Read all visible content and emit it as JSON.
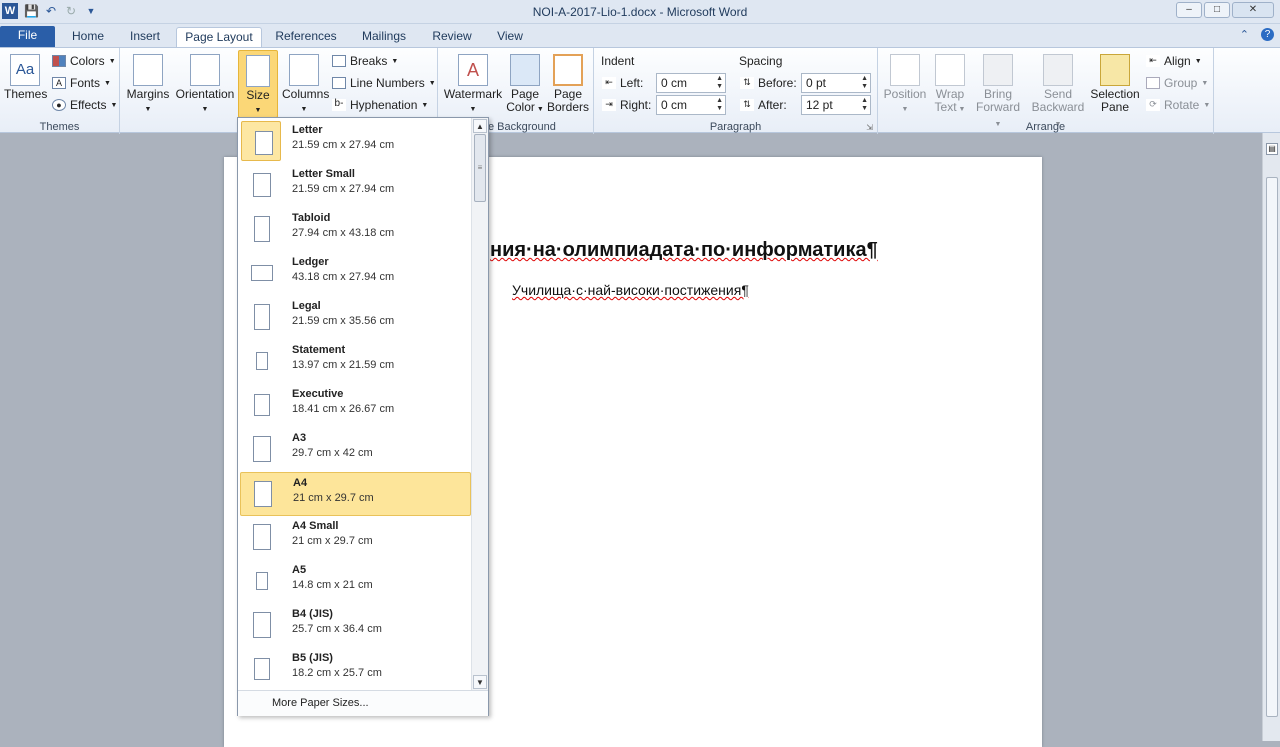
{
  "window": {
    "title": "NOI-A-2017-Lio-1.docx - Microsoft Word",
    "logo": "W",
    "minimize": "–",
    "maximize": "□",
    "close": "✕"
  },
  "tabs": [
    "File",
    "Home",
    "Insert",
    "Page Layout",
    "References",
    "Mailings",
    "Review",
    "View"
  ],
  "ribbon": {
    "themes": {
      "themes_label": "Themes",
      "colors": "Colors",
      "fonts": "Fonts",
      "effects": "Effects",
      "group": "Themes"
    },
    "page_setup": {
      "margins": "Margins",
      "orientation": "Orientation",
      "size": "Size",
      "columns": "Columns",
      "breaks": "Breaks",
      "line_numbers": "Line Numbers",
      "hyphenation": "Hyphenation"
    },
    "page_background": {
      "watermark": "Watermark",
      "page_color_1": "Page",
      "page_color_2": "Color",
      "page_borders_1": "Page",
      "page_borders_2": "Borders",
      "group": "e Background"
    },
    "paragraph": {
      "indent_label": "Indent",
      "left_label": "Left:",
      "left_value": "0 cm",
      "right_label": "Right:",
      "right_value": "0 cm",
      "spacing_label": "Spacing",
      "before_label": "Before:",
      "before_value": "0 pt",
      "after_label": "After:",
      "after_value": "12 pt",
      "group": "Paragraph"
    },
    "arrange": {
      "position": "Position",
      "wrap_1": "Wrap",
      "wrap_2": "Text",
      "bring_1": "Bring",
      "bring_2": "Forward",
      "send_1": "Send",
      "send_2": "Backward",
      "selection_1": "Selection",
      "selection_2": "Pane",
      "align": "Align",
      "group_btn": "Group",
      "rotate": "Rotate",
      "group": "Arrange"
    }
  },
  "document": {
    "heading": "ния·на·олимпиадата·по·информатика¶",
    "subtitle": "Училища·с·най-високи·постижения¶"
  },
  "size_menu": {
    "items": [
      {
        "name": "Letter",
        "dims": "21.59 cm x 27.94 cm"
      },
      {
        "name": "Letter Small",
        "dims": "21.59 cm x 27.94 cm"
      },
      {
        "name": "Tabloid",
        "dims": "27.94 cm x 43.18 cm"
      },
      {
        "name": "Ledger",
        "dims": "43.18 cm x 27.94 cm"
      },
      {
        "name": "Legal",
        "dims": "21.59 cm x 35.56 cm"
      },
      {
        "name": "Statement",
        "dims": "13.97 cm x 21.59 cm"
      },
      {
        "name": "Executive",
        "dims": "18.41 cm x 26.67 cm"
      },
      {
        "name": "A3",
        "dims": "29.7 cm x 42 cm"
      },
      {
        "name": "A4",
        "dims": "21 cm x 29.7 cm"
      },
      {
        "name": "A4 Small",
        "dims": "21 cm x 29.7 cm"
      },
      {
        "name": "A5",
        "dims": "14.8 cm x 21 cm"
      },
      {
        "name": "B4 (JIS)",
        "dims": "25.7 cm x 36.4 cm"
      },
      {
        "name": "B5 (JIS)",
        "dims": "18.2 cm x 25.7 cm"
      }
    ],
    "selected": "A4",
    "current": "Letter",
    "more": "More Paper Sizes..."
  }
}
